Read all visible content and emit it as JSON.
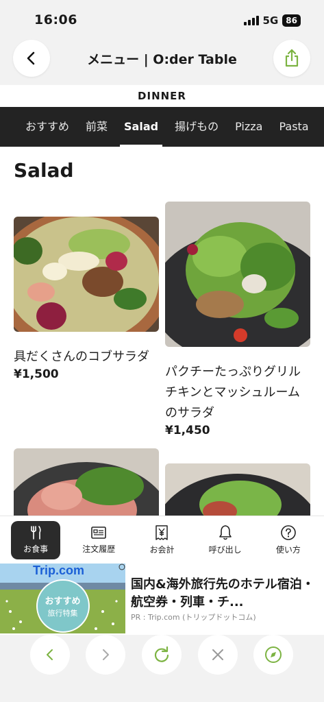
{
  "status_bar": {
    "time": "16:06",
    "network": "5G",
    "battery": "86"
  },
  "header": {
    "title": "メニュー | O:der Table"
  },
  "section": {
    "label": "DINNER"
  },
  "categories": [
    {
      "label": "おすすめ"
    },
    {
      "label": "前菜"
    },
    {
      "label": "Salad",
      "active": true
    },
    {
      "label": "揚げもの"
    },
    {
      "label": "Pizza"
    },
    {
      "label": "Pasta"
    }
  ],
  "page": {
    "heading": "Salad"
  },
  "items": [
    {
      "name": "具だくさんのコブサラダ",
      "price": "¥1,500"
    },
    {
      "name": "パクチーたっぷりグリルチキンとマッシュルームのサラダ",
      "price": "¥1,450"
    }
  ],
  "bottom_nav": [
    {
      "label": "お食事",
      "icon": "fork-knife-icon",
      "active": true
    },
    {
      "label": "注文履歴",
      "icon": "receipt-icon"
    },
    {
      "label": "お会計",
      "icon": "yen-bill-icon"
    },
    {
      "label": "呼び出し",
      "icon": "bell-icon"
    },
    {
      "label": "使い方",
      "icon": "question-icon"
    }
  ],
  "ad": {
    "brand": "Trip.com",
    "badge_line1": "おすすめ",
    "badge_line2": "旅行特集",
    "title": "国内&海外旅行先のホテル宿泊・航空券・列車・チ...",
    "source": "PR : Trip.com (トリップドットコム)"
  },
  "colors": {
    "accent_green": "#7cb342",
    "tab_bar": "#232323",
    "active_bottom_tab": "#2b2b2b"
  }
}
